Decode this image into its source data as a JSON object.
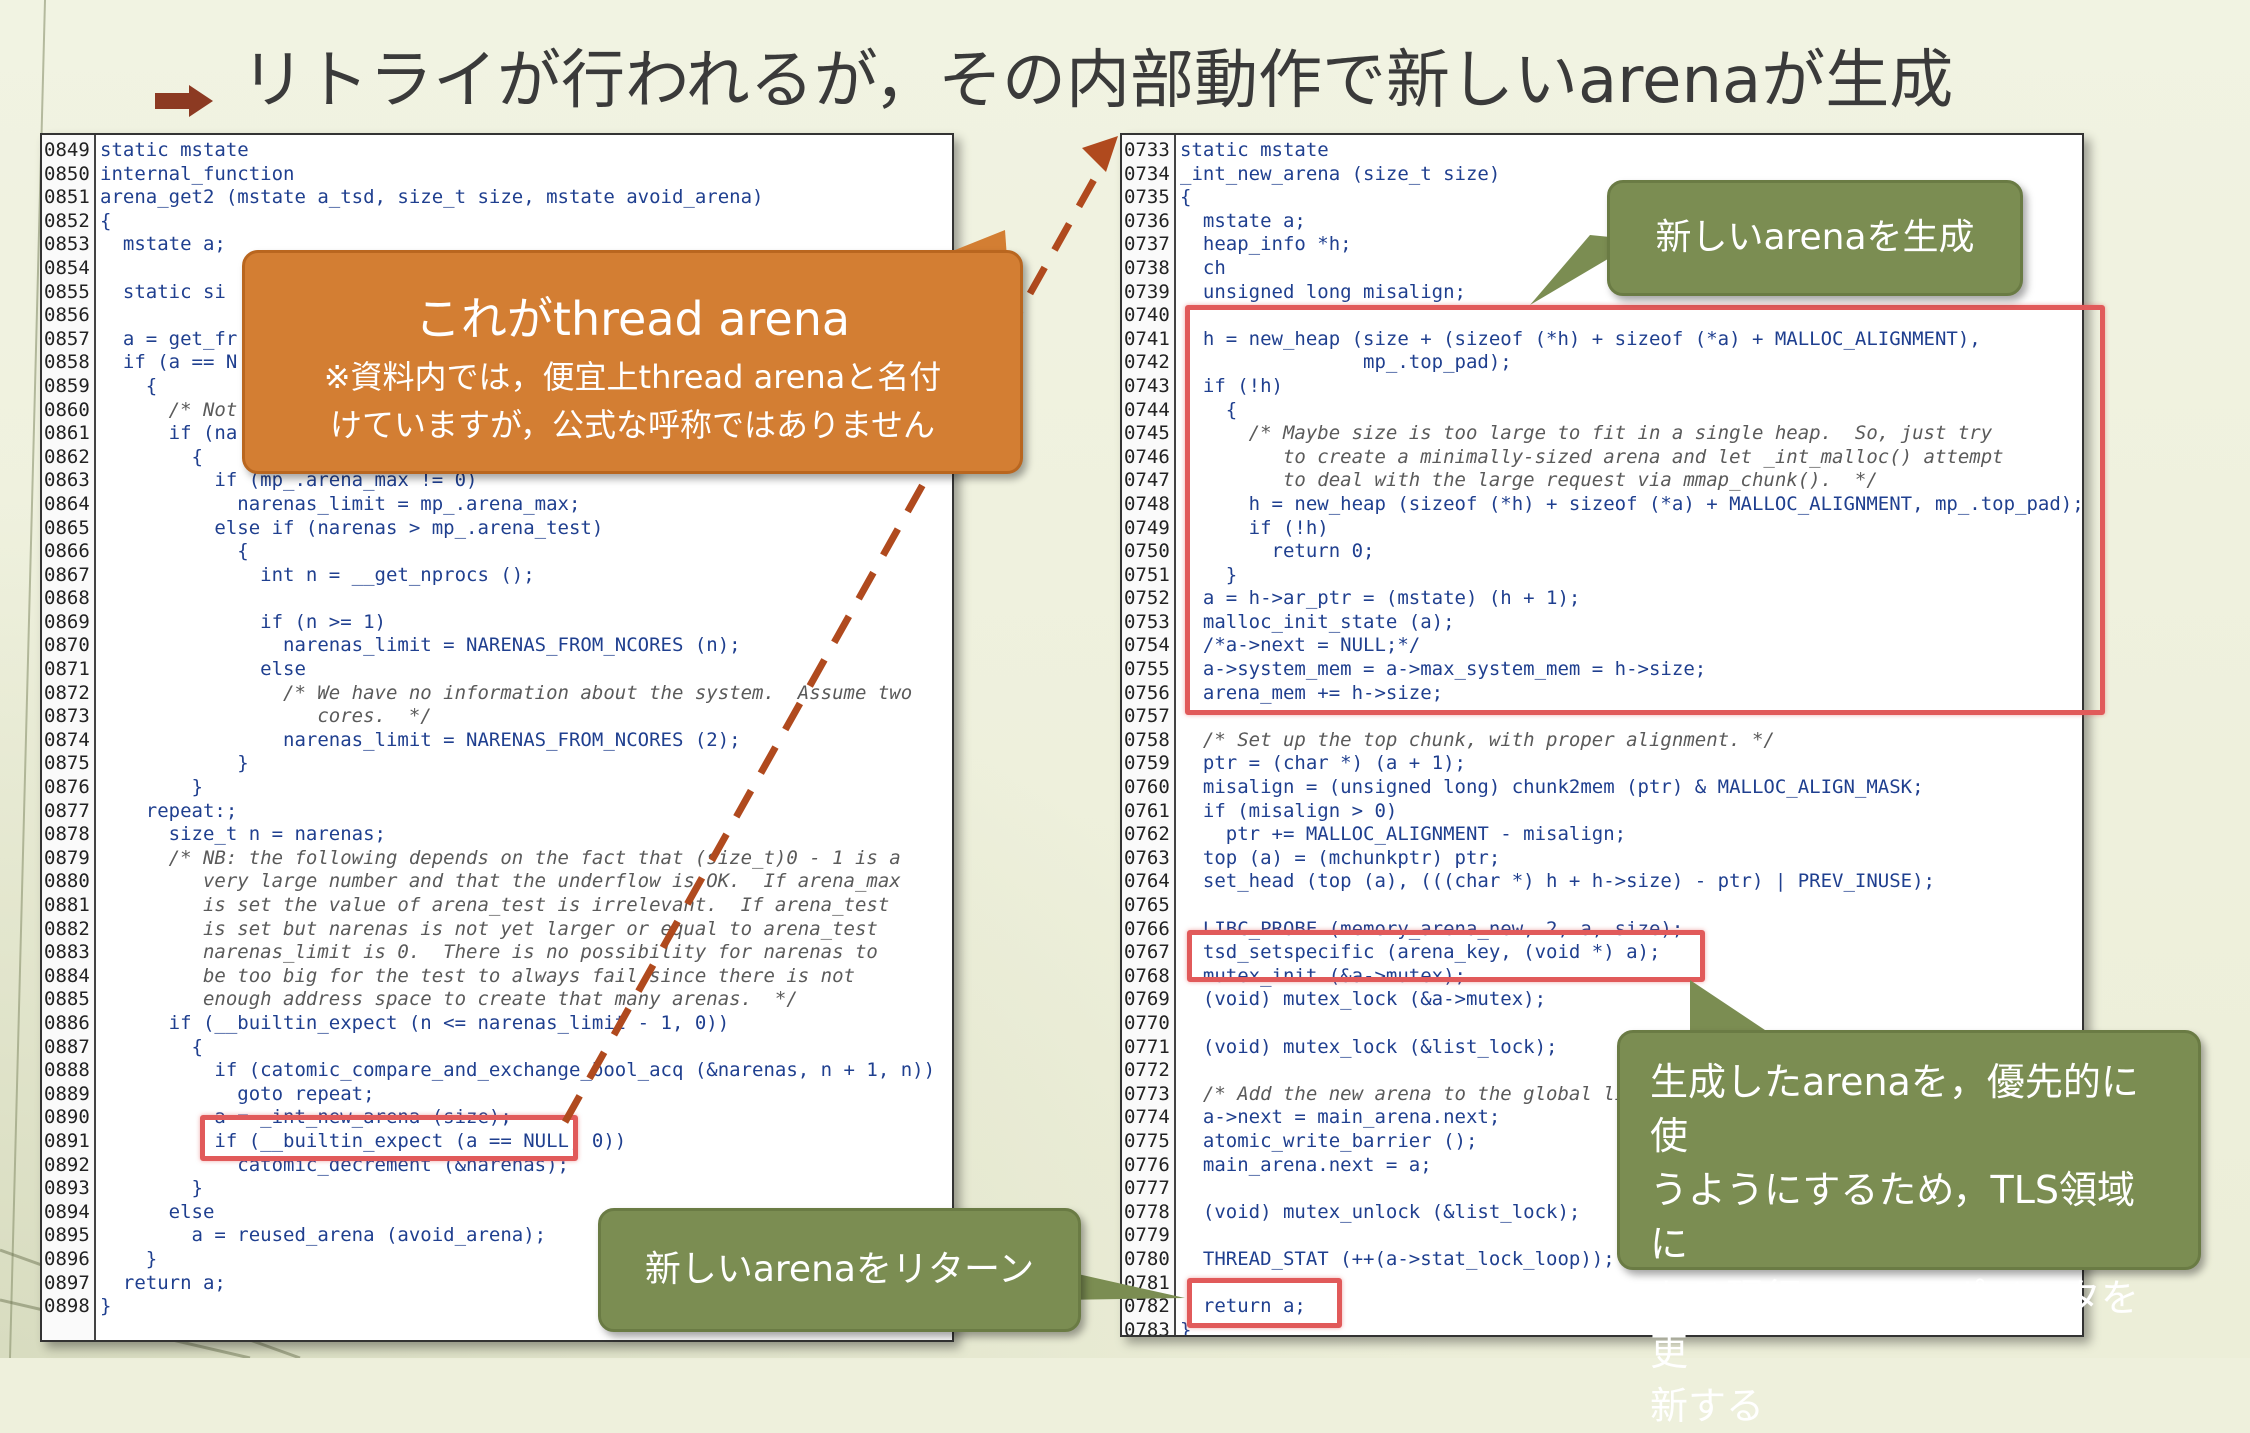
{
  "slide": {
    "title": "リトライが行われるが，その内部動作で新しいarenaが生成"
  },
  "colors": {
    "highlight": "#e15a5a",
    "callout_orange": "#d37e33",
    "callout_green": "#7b8d52",
    "code_text": "#1f3f8f",
    "dashed_arrow": "#b04a1e"
  },
  "left_code": {
    "lines": [
      {
        "n": "0849",
        "t": "static mstate"
      },
      {
        "n": "0850",
        "t": "internal_function"
      },
      {
        "n": "0851",
        "t": "arena_get2 (mstate a_tsd, size_t size, mstate avoid_arena)"
      },
      {
        "n": "0852",
        "t": "{"
      },
      {
        "n": "0853",
        "t": "  mstate a;"
      },
      {
        "n": "0854",
        "t": ""
      },
      {
        "n": "0855",
        "t": "  static si"
      },
      {
        "n": "0856",
        "t": ""
      },
      {
        "n": "0857",
        "t": "  a = get_fr"
      },
      {
        "n": "0858",
        "t": "  if (a == N"
      },
      {
        "n": "0859",
        "t": "    {"
      },
      {
        "n": "0860",
        "t": "      /* Not"
      },
      {
        "n": "0861",
        "t": "      if (na"
      },
      {
        "n": "0862",
        "t": "        {"
      },
      {
        "n": "0863",
        "t": "          if (mp_.arena_max != 0)"
      },
      {
        "n": "0864",
        "t": "            narenas_limit = mp_.arena_max;"
      },
      {
        "n": "0865",
        "t": "          else if (narenas > mp_.arena_test)"
      },
      {
        "n": "0866",
        "t": "            {"
      },
      {
        "n": "0867",
        "t": "              int n = __get_nprocs ();"
      },
      {
        "n": "0868",
        "t": ""
      },
      {
        "n": "0869",
        "t": "              if (n >= 1)"
      },
      {
        "n": "0870",
        "t": "                narenas_limit = NARENAS_FROM_NCORES (n);"
      },
      {
        "n": "0871",
        "t": "              else"
      },
      {
        "n": "0872",
        "t": "                /* We have no information about the system.  Assume two"
      },
      {
        "n": "0873",
        "t": "                   cores.  */"
      },
      {
        "n": "0874",
        "t": "                narenas_limit = NARENAS_FROM_NCORES (2);"
      },
      {
        "n": "0875",
        "t": "            }"
      },
      {
        "n": "0876",
        "t": "        }"
      },
      {
        "n": "0877",
        "t": "    repeat:;"
      },
      {
        "n": "0878",
        "t": "      size_t n = narenas;"
      },
      {
        "n": "0879",
        "t": "      /* NB: the following depends on the fact that (size_t)0 - 1 is a"
      },
      {
        "n": "0880",
        "t": "         very large number and that the underflow is OK.  If arena_max"
      },
      {
        "n": "0881",
        "t": "         is set the value of arena_test is irrelevant.  If arena_test"
      },
      {
        "n": "0882",
        "t": "         is set but narenas is not yet larger or equal to arena_test"
      },
      {
        "n": "0883",
        "t": "         narenas_limit is 0.  There is no possibility for narenas to"
      },
      {
        "n": "0884",
        "t": "         be too big for the test to always fail since there is not"
      },
      {
        "n": "0885",
        "t": "         enough address space to create that many arenas.  */"
      },
      {
        "n": "0886",
        "t": "      if (__builtin_expect (n <= narenas_limit - 1, 0))"
      },
      {
        "n": "0887",
        "t": "        {"
      },
      {
        "n": "0888",
        "t": "          if (catomic_compare_and_exchange_bool_acq (&narenas, n + 1, n))"
      },
      {
        "n": "0889",
        "t": "            goto repeat;"
      },
      {
        "n": "0890",
        "t": "          a = _int_new_arena (size);"
      },
      {
        "n": "0891",
        "t": "          if (__builtin_expect (a == NULL, 0))"
      },
      {
        "n": "0892",
        "t": "            catomic_decrement (&narenas);"
      },
      {
        "n": "0893",
        "t": "        }"
      },
      {
        "n": "0894",
        "t": "      else"
      },
      {
        "n": "0895",
        "t": "        a = reused_arena (avoid_arena);"
      },
      {
        "n": "0896",
        "t": "    }"
      },
      {
        "n": "0897",
        "t": "  return a;"
      },
      {
        "n": "0898",
        "t": "}"
      }
    ]
  },
  "right_code": {
    "lines": [
      {
        "n": "0733",
        "t": "static mstate"
      },
      {
        "n": "0734",
        "t": "_int_new_arena (size_t size)"
      },
      {
        "n": "0735",
        "t": "{"
      },
      {
        "n": "0736",
        "t": "  mstate a;"
      },
      {
        "n": "0737",
        "t": "  heap_info *h;"
      },
      {
        "n": "0738",
        "t": "  ch"
      },
      {
        "n": "0739",
        "t": "  unsigned long misalign;"
      },
      {
        "n": "0740",
        "t": ""
      },
      {
        "n": "0741",
        "t": "  h = new_heap (size + (sizeof (*h) + sizeof (*a) + MALLOC_ALIGNMENT),"
      },
      {
        "n": "0742",
        "t": "                mp_.top_pad);"
      },
      {
        "n": "0743",
        "t": "  if (!h)"
      },
      {
        "n": "0744",
        "t": "    {"
      },
      {
        "n": "0745",
        "t": "      /* Maybe size is too large to fit in a single heap.  So, just try"
      },
      {
        "n": "0746",
        "t": "         to create a minimally-sized arena and let _int_malloc() attempt"
      },
      {
        "n": "0747",
        "t": "         to deal with the large request via mmap_chunk().  */"
      },
      {
        "n": "0748",
        "t": "      h = new_heap (sizeof (*h) + sizeof (*a) + MALLOC_ALIGNMENT, mp_.top_pad);"
      },
      {
        "n": "0749",
        "t": "      if (!h)"
      },
      {
        "n": "0750",
        "t": "        return 0;"
      },
      {
        "n": "0751",
        "t": "    }"
      },
      {
        "n": "0752",
        "t": "  a = h->ar_ptr = (mstate) (h + 1);"
      },
      {
        "n": "0753",
        "t": "  malloc_init_state (a);"
      },
      {
        "n": "0754",
        "t": "  /*a->next = NULL;*/"
      },
      {
        "n": "0755",
        "t": "  a->system_mem = a->max_system_mem = h->size;"
      },
      {
        "n": "0756",
        "t": "  arena_mem += h->size;"
      },
      {
        "n": "0757",
        "t": ""
      },
      {
        "n": "0758",
        "t": "  /* Set up the top chunk, with proper alignment. */"
      },
      {
        "n": "0759",
        "t": "  ptr = (char *) (a + 1);"
      },
      {
        "n": "0760",
        "t": "  misalign = (unsigned long) chunk2mem (ptr) & MALLOC_ALIGN_MASK;"
      },
      {
        "n": "0761",
        "t": "  if (misalign > 0)"
      },
      {
        "n": "0762",
        "t": "    ptr += MALLOC_ALIGNMENT - misalign;"
      },
      {
        "n": "0763",
        "t": "  top (a) = (mchunkptr) ptr;"
      },
      {
        "n": "0764",
        "t": "  set_head (top (a), (((char *) h + h->size) - ptr) | PREV_INUSE);"
      },
      {
        "n": "0765",
        "t": ""
      },
      {
        "n": "0766",
        "t": "  LIBC_PROBE (memory_arena_new, 2, a, size);"
      },
      {
        "n": "0767",
        "t": "  tsd_setspecific (arena_key, (void *) a);"
      },
      {
        "n": "0768",
        "t": "  mutex_init (&a->mutex);"
      },
      {
        "n": "0769",
        "t": "  (void) mutex_lock (&a->mutex);"
      },
      {
        "n": "0770",
        "t": ""
      },
      {
        "n": "0771",
        "t": "  (void) mutex_lock (&list_lock);"
      },
      {
        "n": "0772",
        "t": ""
      },
      {
        "n": "0773",
        "t": "  /* Add the new arena to the global li"
      },
      {
        "n": "0774",
        "t": "  a->next = main_arena.next;"
      },
      {
        "n": "0775",
        "t": "  atomic_write_barrier ();"
      },
      {
        "n": "0776",
        "t": "  main_arena.next = a;"
      },
      {
        "n": "0777",
        "t": ""
      },
      {
        "n": "0778",
        "t": "  (void) mutex_unlock (&list_lock);"
      },
      {
        "n": "0779",
        "t": ""
      },
      {
        "n": "0780",
        "t": "  THREAD_STAT (++(a->stat_lock_loop));"
      },
      {
        "n": "0781",
        "t": ""
      },
      {
        "n": "0782",
        "t": "  return a;"
      },
      {
        "n": "0783",
        "t": "}"
      }
    ]
  },
  "callouts": {
    "thread_arena": {
      "title": "これがthread arena",
      "note_line1": "※資料内では，便宜上thread arenaと名付",
      "note_line2": "けていますが，公式な呼称ではありません"
    },
    "new_arena": "新しいarenaを生成",
    "tls_update": {
      "line1": "生成したarenaを，優先的に使",
      "line2": "うようにするため，TLS領域に",
      "line3": "ある現行arenaのポインタを更",
      "line4": "新する"
    },
    "return_arena": "新しいarenaをリターン"
  }
}
